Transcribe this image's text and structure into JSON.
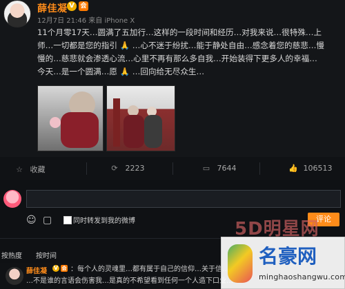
{
  "post": {
    "username": "薛佳凝",
    "badge_v": "V",
    "badge_vip": "会",
    "meta": "12月7日 21:46 来自 iPhone X",
    "lines": [
      "11个月零17天…圆满了五加行…这样的一段时间和经历…对我来说…很特殊…上",
      "师…一切都是您的指引",
      "…心不迷于纷扰…能于静处自由…感念着您的慈悲…慢",
      "慢的…慈悲就会渗透心流…心里不再有那么多自我…开始装得下更多人的幸福…",
      "今天…是一个圆满…愿",
      "…回向给无尽众生…"
    ],
    "prayer_hands": "🙏"
  },
  "actions": {
    "collect": "收藏",
    "repost": "2223",
    "comment": "7644",
    "like": "106513"
  },
  "composer": {
    "forward_label": "同时转发到我的微博",
    "submit_label": "评论"
  },
  "sort": {
    "hot": "按热度",
    "time": "按时间"
  },
  "comment2": {
    "username": "薛佳凝",
    "badge_v": "V",
    "badge_vip": "会",
    "line1": "：每个人的灵魂里…都有属于自己的信仰…关于信…",
    "line2": "…不是谁的言语会伤害我…是真的不希望看到任何一个人造下口业…"
  },
  "watermark": {
    "brand_top": "5D明星网",
    "brand_main": "名豪网",
    "url": "minghaoshangwu.com"
  },
  "icons": {
    "collect": "star-icon",
    "repost": "repost-icon",
    "comment": "comment-bubble-icon",
    "like": "thumbs-up-icon",
    "emoji": "smile-icon",
    "image": "image-icon"
  },
  "colors": {
    "accent": "#ff8c1a",
    "badge_gold": "#f2b000",
    "background": "#0f1114"
  }
}
